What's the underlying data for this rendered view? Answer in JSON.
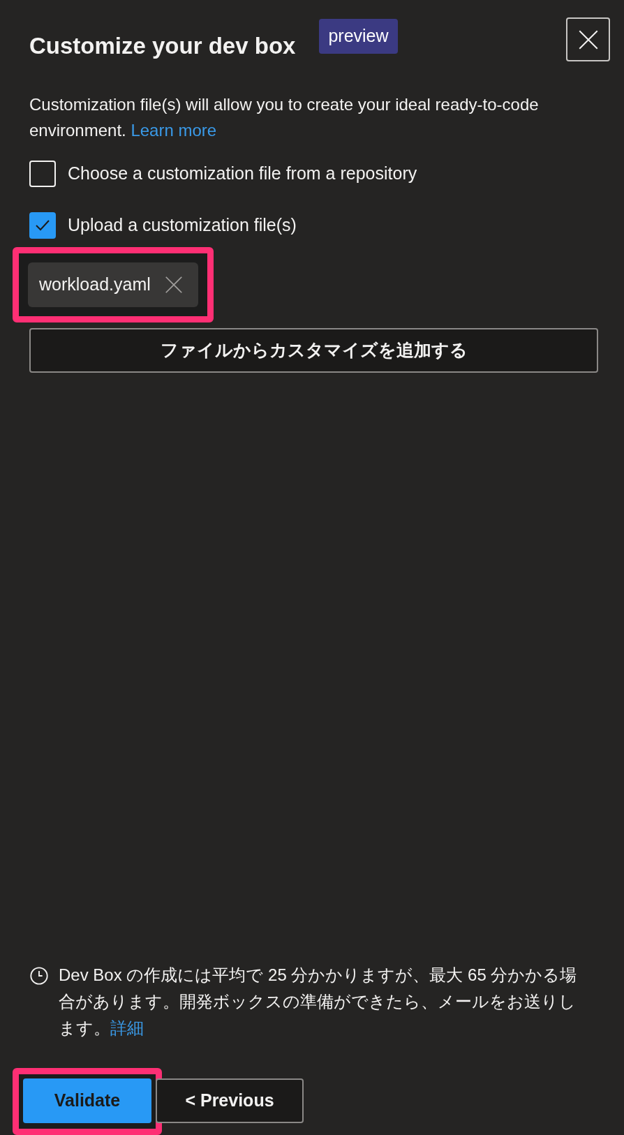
{
  "header": {
    "title": "Customize your dev box",
    "badge": "preview"
  },
  "description": {
    "text": "Customization file(s) will allow you to create your ideal ready-to-code environment.",
    "link": "Learn more"
  },
  "options": [
    {
      "label": "Choose a customization file from a repository",
      "checked": false
    },
    {
      "label": "Upload a customization file(s)",
      "checked": true
    }
  ],
  "files": [
    {
      "name": "workload.yaml",
      "highlighted": true
    }
  ],
  "add_button": "ファイルからカスタマイズを追加する",
  "note": {
    "text": "Dev Box の作成には平均で 25 分かかりますが、最大 65 分かかる場合があります。開発ボックスの準備ができたら、メールをお送りします。",
    "link": "詳細"
  },
  "buttons": [
    {
      "label": "Validate",
      "kind": "primary",
      "highlighted": true
    },
    {
      "label": "< Previous",
      "kind": "secondary",
      "highlighted": false
    }
  ]
}
